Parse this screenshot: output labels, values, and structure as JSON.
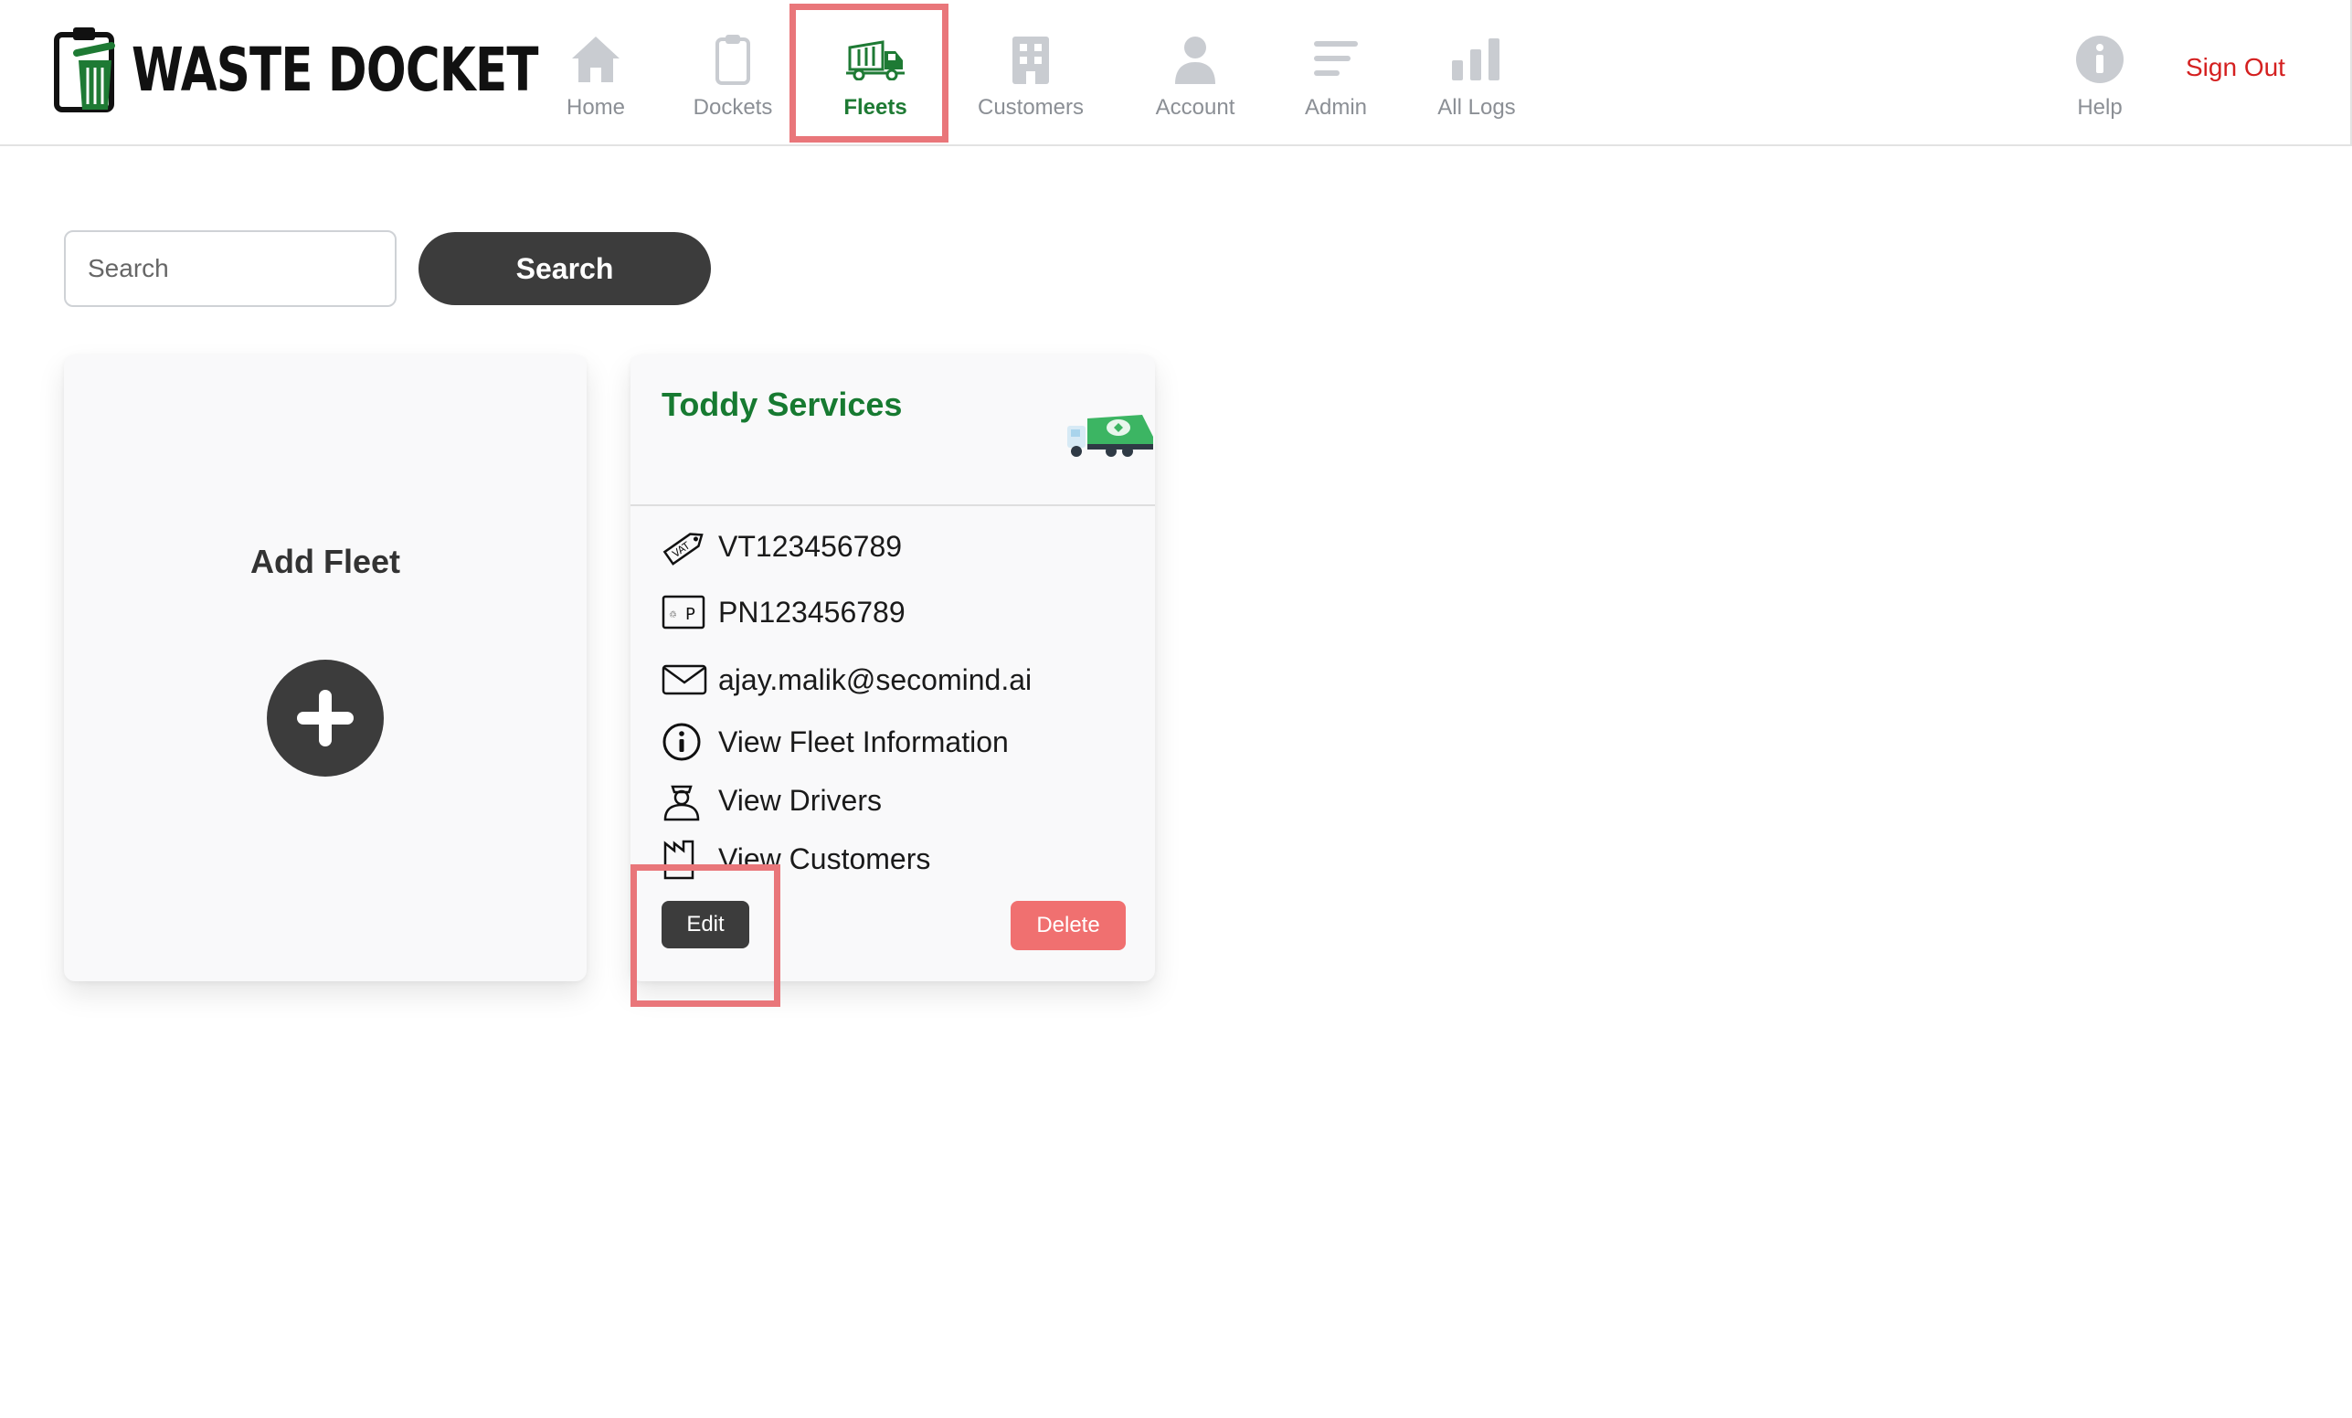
{
  "app": {
    "logo_text": "WASTE DOCKET"
  },
  "nav": {
    "items": [
      {
        "label": "Home",
        "icon": "home-icon"
      },
      {
        "label": "Dockets",
        "icon": "clipboard-icon"
      },
      {
        "label": "Fleets",
        "icon": "garbage-truck-icon",
        "active": true
      },
      {
        "label": "Customers",
        "icon": "building-icon"
      },
      {
        "label": "Account",
        "icon": "user-icon"
      },
      {
        "label": "Admin",
        "icon": "menu-lines-icon"
      },
      {
        "label": "All Logs",
        "icon": "bar-chart-icon"
      }
    ],
    "help_label": "Help",
    "sign_out": "Sign Out"
  },
  "search": {
    "placeholder": "Search",
    "button_label": "Search"
  },
  "add_fleet": {
    "title": "Add Fleet"
  },
  "fleet": {
    "name": "Toddy Services",
    "vat": "VT123456789",
    "pn": "PN123456789",
    "email": "ajay.malik@secomind.ai",
    "links": {
      "info": "View Fleet Information",
      "drivers": "View Drivers",
      "customers": "View Customers"
    },
    "edit_label": "Edit",
    "delete_label": "Delete"
  },
  "colors": {
    "brand_green": "#1e7a34",
    "dark_button": "#3c3c3c",
    "delete_red": "#f07070",
    "sign_out_red": "#d42020",
    "highlight": "#e9767a"
  }
}
